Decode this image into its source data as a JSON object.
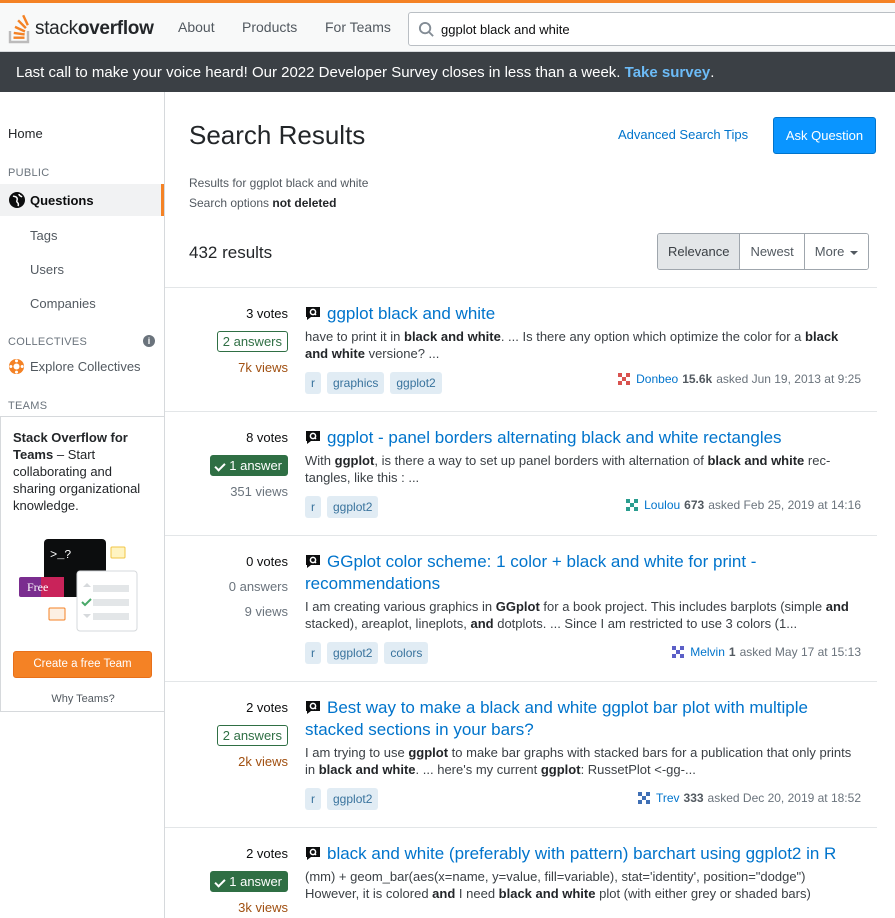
{
  "topbar": {
    "logo_text_light": "stack",
    "logo_text_bold": "overflow",
    "nav": [
      "About",
      "Products",
      "For Teams"
    ],
    "search_value": "ggplot black and white"
  },
  "banner": {
    "text": "Last call to make your voice heard! Our 2022 Developer Survey closes in less than a week. ",
    "link": "Take survey",
    "suffix": "."
  },
  "sidebar": {
    "home": "Home",
    "public_heading": "PUBLIC",
    "questions": "Questions",
    "tags": "Tags",
    "users": "Users",
    "companies": "Companies",
    "collectives_heading": "COLLECTIVES",
    "explore_collectives": "Explore Collectives",
    "teams_heading": "TEAMS",
    "teams_title": "Stack Overflow for Teams",
    "teams_desc": " – Start collaborating and sharing organizational knowledge.",
    "teams_illus_badge": "Free",
    "teams_illus_prompt": ">_?",
    "create_team": "Create a free Team",
    "why_teams": "Why Teams?"
  },
  "main": {
    "title": "Search Results",
    "advanced_tips": "Advanced Search Tips",
    "ask_question": "Ask Question",
    "results_for": "Results for ggplot black and white",
    "search_options_prefix": "Search options ",
    "search_options_value": "not deleted",
    "result_count": "432 results",
    "sort": [
      "Relevance",
      "Newest",
      "More"
    ]
  },
  "questions": [
    {
      "votes": "3 votes",
      "answers": "2 answers",
      "accepted": false,
      "views": "7k views",
      "views_hot": true,
      "title": "ggplot black and white",
      "excerpt_html": "have to print it in <b>black and white</b>. ... Is there any option which optimize the color for a <b>black and white</b> versione? ...",
      "tags": [
        "r",
        "graphics",
        "ggplot2"
      ],
      "user": "Donbeo",
      "rep": "15.6k",
      "asked": "asked Jun 19, 2013 at 9:25",
      "avatar_color": "#d9534f"
    },
    {
      "votes": "8 votes",
      "answers": "1 answer",
      "accepted": true,
      "views": "351 views",
      "views_hot": false,
      "title": "ggplot - panel borders alternating black and white rectangles",
      "excerpt_html": "With <b>ggplot</b>, is there a way to set up panel borders with alternation of <b>black and white</b> rec-tangles, like this : ...",
      "tags": [
        "r",
        "ggplot2"
      ],
      "user": "Loulou",
      "rep": "673",
      "asked": "asked Feb 25, 2019 at 14:16",
      "avatar_color": "#2a9d8f"
    },
    {
      "votes": "0 votes",
      "answers": "0 answers",
      "accepted": false,
      "no_answer": true,
      "views": "9 views",
      "views_hot": false,
      "title": "GGplot color scheme: 1 color + black and white for print - recommendations",
      "excerpt_html": "I am creating various graphics in <b>GGplot</b> for a book project. This includes barplots (simple <b>and</b> stacked), areaplot, lineplots, <b>and</b> dotplots. ... Since I am restricted to use 3 colors (1...",
      "tags": [
        "r",
        "ggplot2",
        "colors"
      ],
      "user": "Melvin",
      "rep": "1",
      "asked": "asked May 17 at 15:13",
      "avatar_color": "#5b5fc7"
    },
    {
      "votes": "2 votes",
      "answers": "2 answers",
      "accepted": false,
      "views": "2k views",
      "views_hot": true,
      "title": "Best way to make a black and white ggplot bar plot with multiple stacked sections in your bars?",
      "excerpt_html": "I am trying to use <b>ggplot</b> to make bar graphs with stacked bars for a publication that only prints in <b>black and white</b>. ... here's my current <b>ggplot</b>: RussetPlot &lt;-gg-...",
      "tags": [
        "r",
        "ggplot2"
      ],
      "user": "Trev",
      "rep": "333",
      "asked": "asked Dec 20, 2019 at 18:52",
      "avatar_color": "#3f6fb5"
    },
    {
      "votes": "2 votes",
      "answers": "1 answer",
      "accepted": true,
      "views": "3k views",
      "views_hot": true,
      "title": "black and white (preferably with pattern) barchart using ggplot2 in R",
      "excerpt_html": "(mm) + geom_bar(aes(x=name, y=value, fill=variable), stat='identity', position=\"dodge\") However, it is colored <b>and</b> I need <b>black and white</b> plot (with either grey or shaded bars)",
      "tags": [],
      "user": "",
      "rep": "",
      "asked": "",
      "avatar_color": "#888888"
    }
  ]
}
